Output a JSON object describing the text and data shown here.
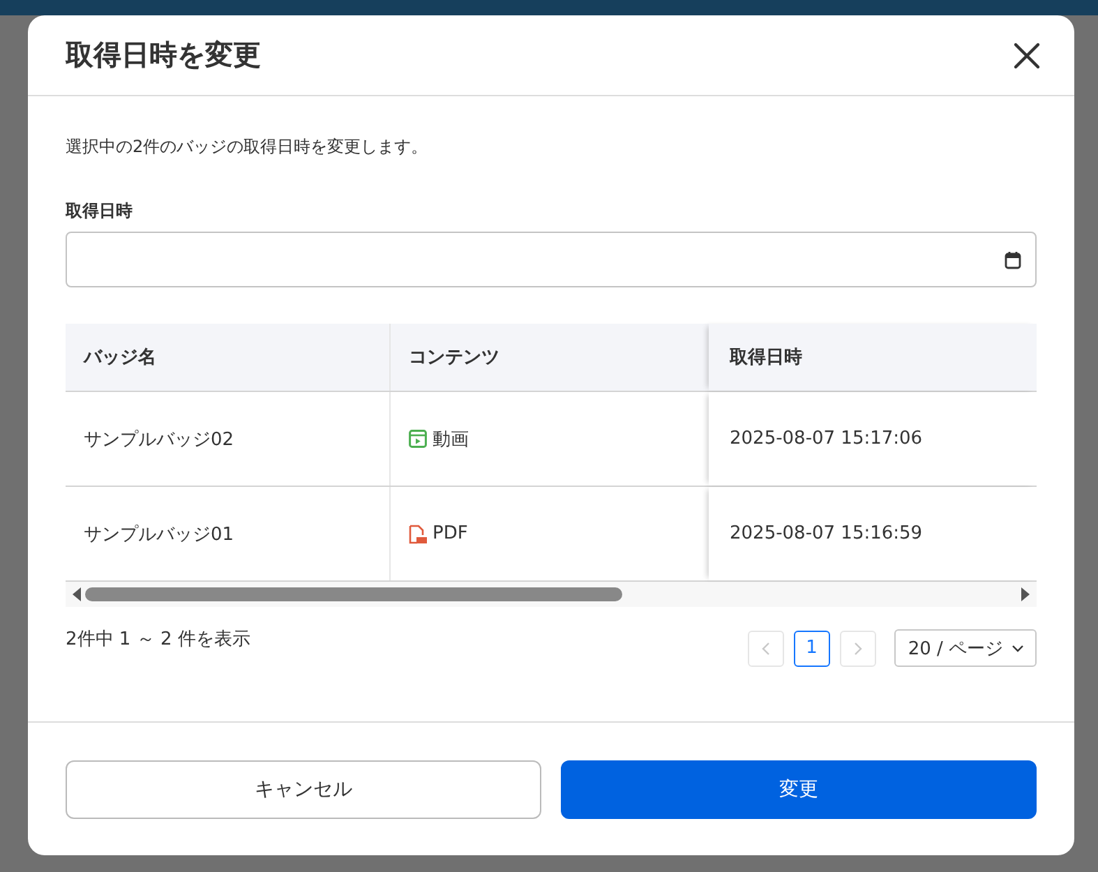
{
  "dialog": {
    "title": "取得日時を変更",
    "description": "選択中の2件のバッジの取得日時を変更します。",
    "field": {
      "label": "取得日時"
    },
    "table": {
      "columns": [
        "バッジ名",
        "コンテンツ",
        "取得日時"
      ],
      "rows": [
        {
          "name": "サンプルバッジ02",
          "content": {
            "kind": "video",
            "label": "動画"
          },
          "acquired": "2025-08-07 15:17:06"
        },
        {
          "name": "サンプルバッジ01",
          "content": {
            "kind": "pdf",
            "label": "PDF"
          },
          "acquired": "2025-08-07 15:16:59"
        }
      ]
    },
    "pagination": {
      "summary": "2件中 1 ～ 2 件を表示",
      "prev_disabled": true,
      "next_disabled": true,
      "pages": [
        {
          "label": "1",
          "selected": true
        }
      ],
      "page_size": "20 / ページ"
    },
    "buttons": [
      {
        "label": "キャンセル",
        "kind": "secondary"
      },
      {
        "label": "変更",
        "kind": "primary"
      }
    ]
  }
}
